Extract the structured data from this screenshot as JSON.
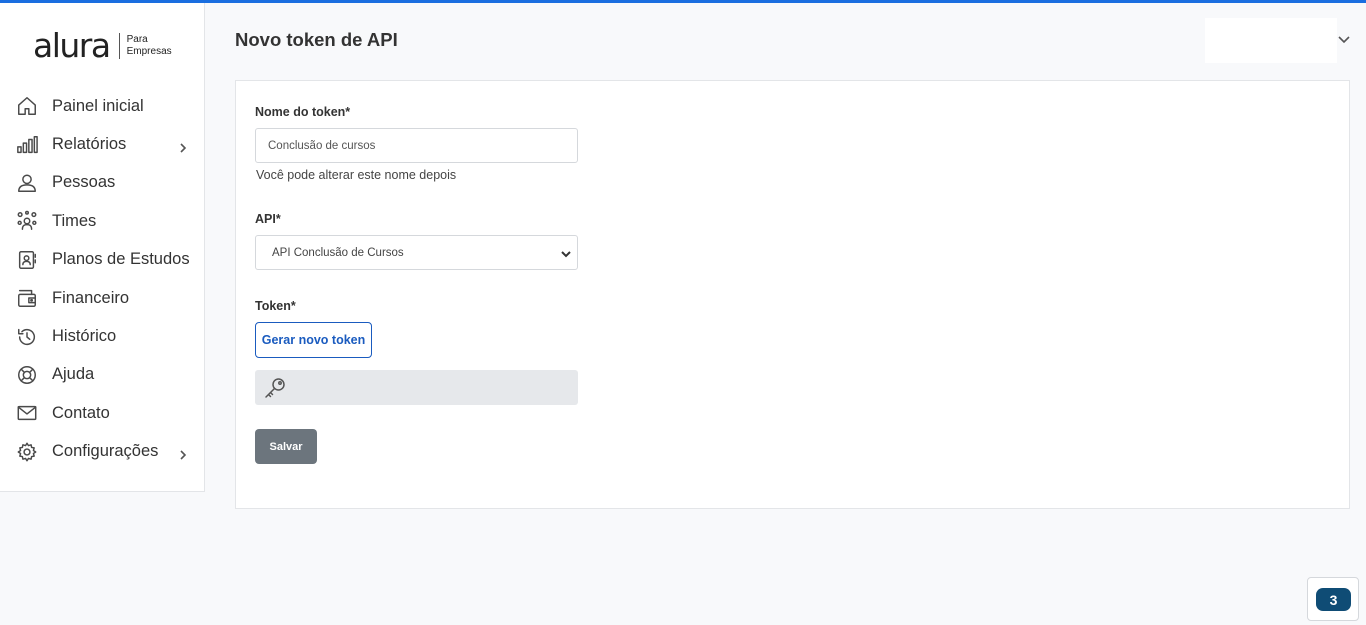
{
  "brand": {
    "name": "alura",
    "sub_line1": "Para",
    "sub_line2": "Empresas",
    "accent_color": "#1a6ee0"
  },
  "sidebar": {
    "items": [
      {
        "label": "Painel inicial",
        "icon": "home-icon"
      },
      {
        "label": "Relatórios",
        "icon": "bar-chart-icon",
        "has_submenu": true
      },
      {
        "label": "Pessoas",
        "icon": "person-icon"
      },
      {
        "label": "Times",
        "icon": "team-icon"
      },
      {
        "label": "Planos de Estudos",
        "icon": "study-plan-icon"
      },
      {
        "label": "Financeiro",
        "icon": "wallet-icon"
      },
      {
        "label": "Histórico",
        "icon": "history-icon"
      },
      {
        "label": "Ajuda",
        "icon": "lifebuoy-icon"
      },
      {
        "label": "Contato",
        "icon": "mail-icon"
      },
      {
        "label": "Configurações",
        "icon": "gear-icon",
        "has_submenu": true
      }
    ]
  },
  "header": {
    "title": "Novo token de API"
  },
  "form": {
    "name_label": "Nome do token*",
    "name_value": "Conclusão de cursos",
    "name_help": "Você pode alterar este nome depois",
    "api_label": "API*",
    "api_selected": "API Conclusão de Cursos",
    "token_label": "Token*",
    "generate_button": "Gerar novo token",
    "token_value": "",
    "save_button": "Salvar"
  },
  "badge": {
    "count": "3",
    "color": "#0f4c75"
  }
}
